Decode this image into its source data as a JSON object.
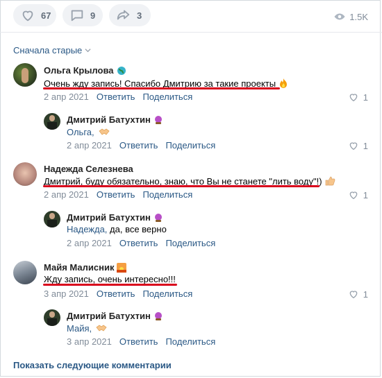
{
  "actions": {
    "likes": "67",
    "comments": "9",
    "shares": "3",
    "views": "1.5K"
  },
  "sort_label": "Сначала старые",
  "comments": [
    {
      "author": "Ольга Крылова",
      "text": "Очень жду запись! Спасибо Дмитрию за такие проекты",
      "date": "2 апр 2021",
      "reply_label": "Ответить",
      "share_label": "Поделиться",
      "likes": "1"
    },
    {
      "author": "Дмитрий Батухтин",
      "text_link": "Ольга,",
      "text": "",
      "date": "2 апр 2021",
      "reply_label": "Ответить",
      "share_label": "Поделиться",
      "likes": "1"
    },
    {
      "author": "Надежда Селезнева",
      "text": "Дмитрий, буду обязательно, знаю, что Вы не станете \"лить воду\"!)",
      "date": "2 апр 2021",
      "reply_label": "Ответить",
      "share_label": "Поделиться",
      "likes": "1"
    },
    {
      "author": "Дмитрий Батухтин",
      "text_link": "Надежда,",
      "text": " да, все верно",
      "date": "2 апр 2021",
      "reply_label": "Ответить",
      "share_label": "Поделиться",
      "likes": ""
    },
    {
      "author": "Майя Малисник",
      "text": "Жду запись, очень интересно!!!",
      "date": "3 апр 2021",
      "reply_label": "Ответить",
      "share_label": "Поделиться",
      "likes": "1"
    },
    {
      "author": "Дмитрий Батухтин",
      "text_link": "Майя,",
      "text": "",
      "date": "3 апр 2021",
      "reply_label": "Ответить",
      "share_label": "Поделиться",
      "likes": ""
    }
  ],
  "show_more": "Показать следующие комментарии",
  "colors": {
    "link": "#2a5885",
    "underline": "#d9001b",
    "muted": "#818c99"
  }
}
